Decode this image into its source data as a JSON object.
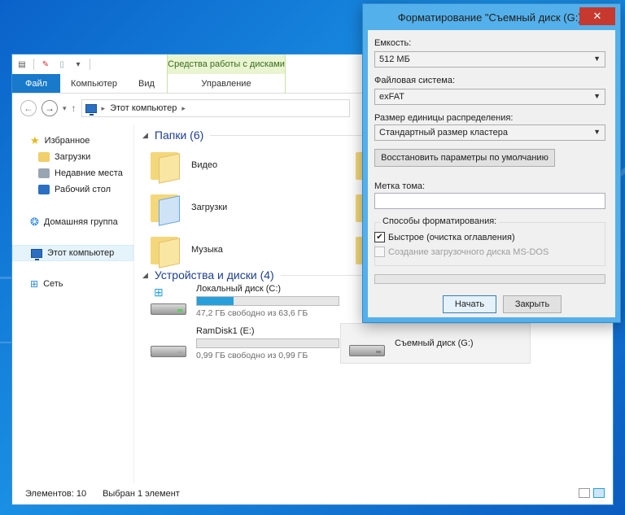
{
  "explorer": {
    "ribbon": {
      "tools_title": "Средства работы с дисками",
      "tabs": [
        "Файл",
        "Компьютер",
        "Вид"
      ],
      "manage_tab": "Управление"
    },
    "address": {
      "path": "Этот компьютер"
    },
    "nav": {
      "favorites": "Избранное",
      "downloads": "Загрузки",
      "recent": "Недавние места",
      "desktop": "Рабочий стол",
      "homegroup": "Домашняя группа",
      "this_pc": "Этот компьютер",
      "network": "Сеть"
    },
    "folders_header": "Папки (6)",
    "folders": [
      "Видео",
      "Загрузки",
      "Музыка"
    ],
    "devices_header": "Устройства и диски (4)",
    "drives": [
      {
        "name": "Локальный диск (C:)",
        "free": "47,2 ГБ свободно из 63,6 ГБ",
        "used_fraction": 0.26
      },
      {
        "name": "RamDisk1 (E:)",
        "free": "0,99 ГБ свободно из 0,99 ГБ",
        "used_fraction": 0.0
      },
      {
        "name": "Съемный диск (G:)"
      }
    ],
    "status": {
      "items": "Элементов: 10",
      "selected": "Выбран 1 элемент"
    }
  },
  "dialog": {
    "title": "Форматирование \"Съемный диск (G:)\"",
    "close_glyph": "✕",
    "capacity_label": "Емкость:",
    "capacity_value": "512 МБ",
    "fs_label": "Файловая система:",
    "fs_value": "exFAT",
    "cluster_label": "Размер единицы распределения:",
    "cluster_value": "Стандартный размер кластера",
    "restore_button": "Восстановить параметры по умолчанию",
    "volume_label": "Метка тома:",
    "volume_value": "",
    "options_legend": "Способы форматирования:",
    "quick_format": "Быстрое (очистка оглавления)",
    "quick_checked": true,
    "msdos": "Создание загрузочного диска MS-DOS",
    "start_button": "Начать",
    "close_button": "Закрыть"
  }
}
